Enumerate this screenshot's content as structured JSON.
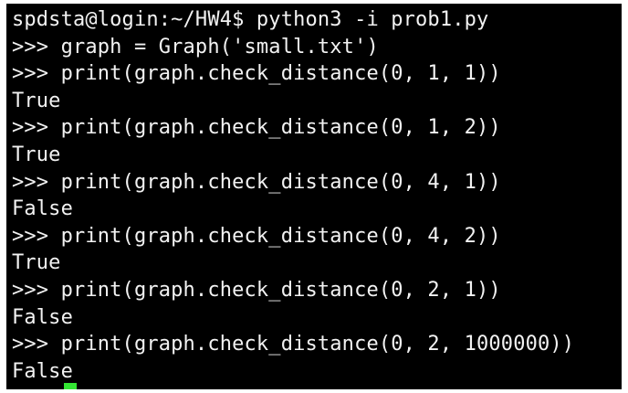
{
  "terminal": {
    "lines": [
      "spdsta@login:~/HW4$ python3 -i prob1.py",
      ">>> graph = Graph('small.txt')",
      ">>> print(graph.check_distance(0, 1, 1))",
      "True",
      ">>> print(graph.check_distance(0, 1, 2))",
      "True",
      ">>> print(graph.check_distance(0, 4, 1))",
      "False",
      ">>> print(graph.check_distance(0, 4, 2))",
      "True",
      ">>> print(graph.check_distance(0, 2, 1))",
      "False",
      ">>> print(graph.check_distance(0, 2, 1000000))",
      "False"
    ],
    "cursor_color": "#33e633",
    "background_color": "#000000",
    "text_color": "#f2f2f2"
  }
}
